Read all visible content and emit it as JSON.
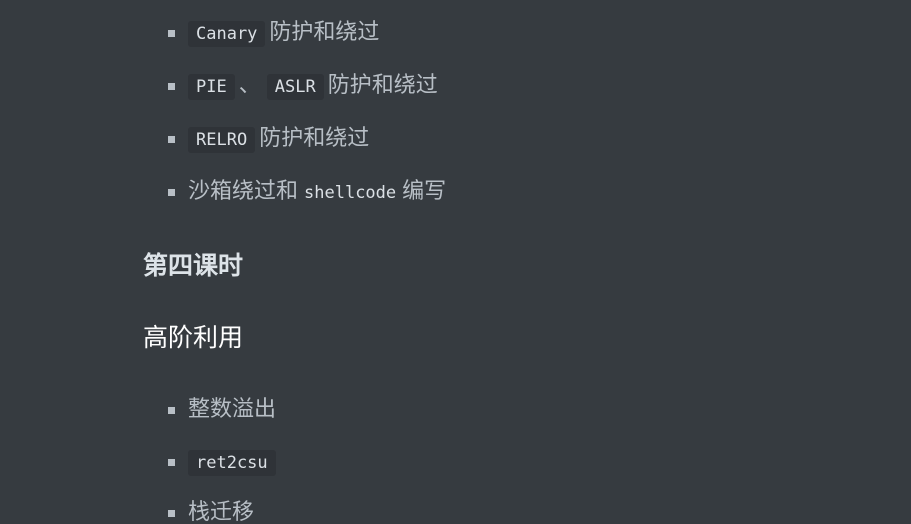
{
  "list1": {
    "items": [
      {
        "code": "Canary",
        "text": "防护和绕过"
      },
      {
        "code1": "PIE",
        "sep": "、",
        "code2": "ASLR",
        "text": "防护和绕过"
      },
      {
        "code": "RELRO",
        "text": "防护和绕过"
      },
      {
        "text_before": "沙箱绕过和",
        "code": "shellcode",
        "text_after": "编写"
      }
    ]
  },
  "lesson_heading": "第四课时",
  "section_heading": "高阶利用",
  "list2": {
    "items": [
      {
        "text": "整数溢出"
      },
      {
        "code": "ret2csu"
      },
      {
        "text": "栈迁移"
      }
    ]
  }
}
